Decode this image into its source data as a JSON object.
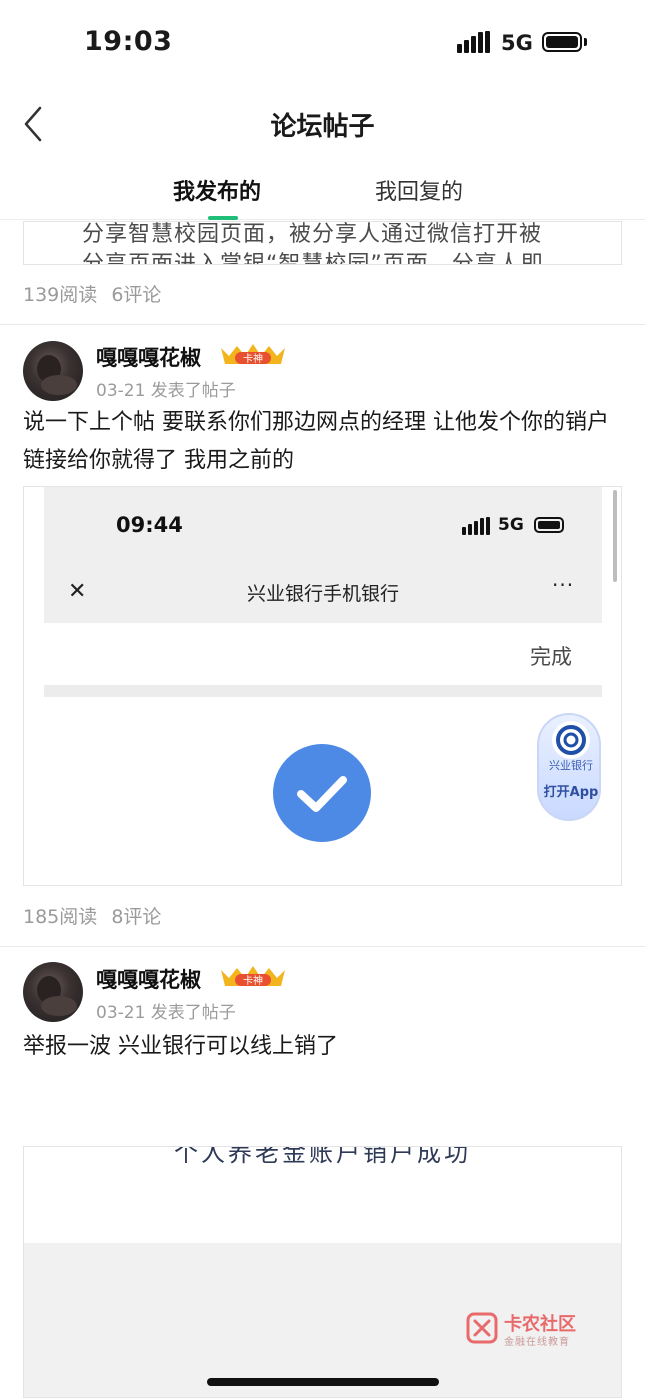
{
  "status_bar": {
    "time": "19:03",
    "network": "5G"
  },
  "nav": {
    "title": "论坛帖子"
  },
  "tabs": [
    {
      "label": "我发布的",
      "active": true
    },
    {
      "label": "我回复的",
      "active": false
    }
  ],
  "posts": [
    {
      "image_text": [
        "分享智慧校园页面，被分享人通过微信打开被",
        "分享页面进入掌银“智慧校园”页面，分享人即"
      ],
      "views": "139阅读",
      "comments": "6评论"
    },
    {
      "username": "嘎嘎嘎花椒",
      "badge": "卡神",
      "meta": "03-21 发表了帖子",
      "body": "说一下上个帖 要联系你们那边网点的经理 让他发个你的销户链接给你就得了 我用之前的",
      "image": {
        "time": "09:44",
        "network": "5G",
        "title": "兴业银行手机银行",
        "more": "···",
        "done": "完成",
        "bank_name": "兴业银行",
        "open_app": "打开App"
      },
      "views": "185阅读",
      "comments": "8评论"
    },
    {
      "username": "嘎嘎嘎花椒",
      "badge": "卡神",
      "meta": "03-21 发表了帖子",
      "body": "举报一波 兴业银行可以线上销了",
      "image_text": "个人养老金账户销户成功"
    }
  ],
  "watermark": {
    "name": "卡农社区",
    "sub": "金融在线教育"
  },
  "colors": {
    "accent": "#1fbf7a",
    "check": "#4d8ae6",
    "badge_gold": "#f2b51e"
  }
}
